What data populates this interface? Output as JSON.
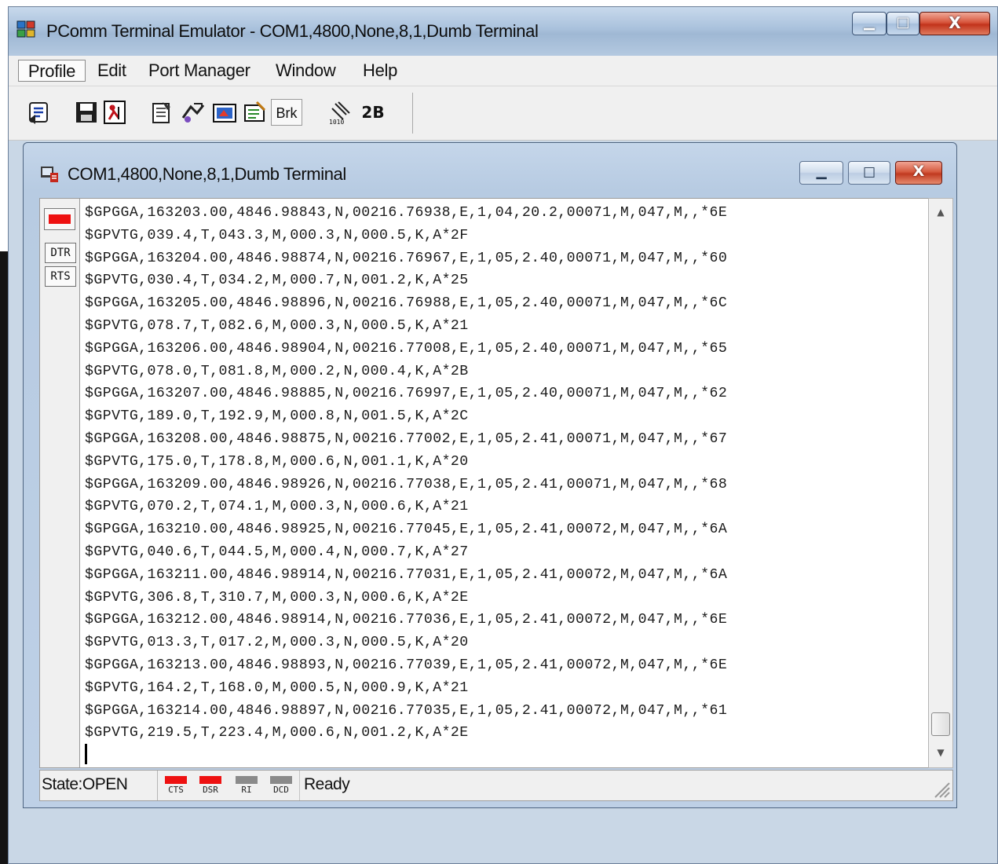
{
  "app": {
    "title": "PComm Terminal Emulator - COM1,4800,None,8,1,Dumb Terminal"
  },
  "menu": {
    "items": [
      "Profile",
      "Edit",
      "Port Manager",
      "Window",
      "Help"
    ]
  },
  "toolbar": {
    "buttons": [
      {
        "icon": "dial-icon"
      },
      {
        "icon": "save-icon"
      },
      {
        "icon": "exit-icon"
      },
      {
        "icon": "settings-icon"
      },
      {
        "icon": "transfer-icon"
      },
      {
        "icon": "capture-icon"
      },
      {
        "icon": "script-icon"
      },
      {
        "label": "Brk"
      },
      {
        "icon": "signal-icon"
      },
      {
        "label": "2B"
      }
    ]
  },
  "terminal_window": {
    "title": "COM1,4800,None,8,1,Dumb Terminal",
    "signals": {
      "dtr_label": "DTR",
      "rts_label": "RTS"
    },
    "lines": [
      "$GPGGA,163203.00,4846.98843,N,00216.76938,E,1,04,20.2,00071,M,047,M,,*6E",
      "$GPVTG,039.4,T,043.3,M,000.3,N,000.5,K,A*2F",
      "$GPGGA,163204.00,4846.98874,N,00216.76967,E,1,05,2.40,00071,M,047,M,,*60",
      "$GPVTG,030.4,T,034.2,M,000.7,N,001.2,K,A*25",
      "$GPGGA,163205.00,4846.98896,N,00216.76988,E,1,05,2.40,00071,M,047,M,,*6C",
      "$GPVTG,078.7,T,082.6,M,000.3,N,000.5,K,A*21",
      "$GPGGA,163206.00,4846.98904,N,00216.77008,E,1,05,2.40,00071,M,047,M,,*65",
      "$GPVTG,078.0,T,081.8,M,000.2,N,000.4,K,A*2B",
      "$GPGGA,163207.00,4846.98885,N,00216.76997,E,1,05,2.40,00071,M,047,M,,*62",
      "$GPVTG,189.0,T,192.9,M,000.8,N,001.5,K,A*2C",
      "$GPGGA,163208.00,4846.98875,N,00216.77002,E,1,05,2.41,00071,M,047,M,,*67",
      "$GPVTG,175.0,T,178.8,M,000.6,N,001.1,K,A*20",
      "$GPGGA,163209.00,4846.98926,N,00216.77038,E,1,05,2.41,00071,M,047,M,,*68",
      "$GPVTG,070.2,T,074.1,M,000.3,N,000.6,K,A*21",
      "$GPGGA,163210.00,4846.98925,N,00216.77045,E,1,05,2.41,00072,M,047,M,,*6A",
      "$GPVTG,040.6,T,044.5,M,000.4,N,000.7,K,A*27",
      "$GPGGA,163211.00,4846.98914,N,00216.77031,E,1,05,2.41,00072,M,047,M,,*6A",
      "$GPVTG,306.8,T,310.7,M,000.3,N,000.6,K,A*2E",
      "$GPGGA,163212.00,4846.98914,N,00216.77036,E,1,05,2.41,00072,M,047,M,,*6E",
      "$GPVTG,013.3,T,017.2,M,000.3,N,000.5,K,A*20",
      "$GPGGA,163213.00,4846.98893,N,00216.77039,E,1,05,2.41,00072,M,047,M,,*6E",
      "$GPVTG,164.2,T,168.0,M,000.5,N,000.9,K,A*21",
      "$GPGGA,163214.00,4846.98897,N,00216.77035,E,1,05,2.41,00072,M,047,M,,*61",
      "$GPVTG,219.5,T,223.4,M,000.6,N,001.2,K,A*2E"
    ]
  },
  "status": {
    "state": "State:OPEN",
    "lamps": [
      {
        "label": "CTS",
        "color": "#ee1111"
      },
      {
        "label": "DSR",
        "color": "#ee1111"
      },
      {
        "label": "RI",
        "color": "#8a8a8a"
      },
      {
        "label": "DCD",
        "color": "#8a8a8a"
      }
    ],
    "message": "Ready"
  },
  "colors": {
    "signal_on": "#ee1111",
    "signal_off": "#8a8a8a",
    "titlebar": "#a9c1dc"
  }
}
